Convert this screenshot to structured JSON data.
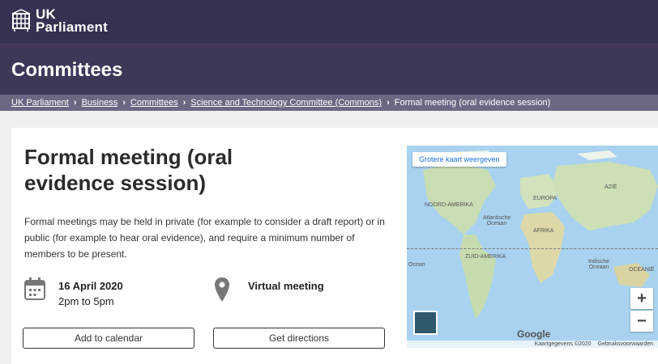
{
  "header": {
    "brand_line1": "UK",
    "brand_line2": "Parliament"
  },
  "section": {
    "title": "Committees"
  },
  "breadcrumb": {
    "items": [
      "UK Parliament",
      "Business",
      "Committees",
      "Science and Technology Committee (Commons)"
    ],
    "current": "Formal meeting (oral evidence session)"
  },
  "event": {
    "title": "Formal meeting (oral evidence session)",
    "description": "Formal meetings may be held in private (for example to consider a draft report) or in public (for example to hear oral evidence), and require a minimum number of members to be present.",
    "date": "16 April 2020",
    "time": "2pm to 5pm",
    "location": "Virtual meeting",
    "add_calendar_label": "Add to calendar",
    "directions_label": "Get directions"
  },
  "map": {
    "bigger_map_label": "Grotere kaart weergeven",
    "labels": {
      "north_america": "NOORD-AMERIKA",
      "europe": "EUROPA",
      "asia": "AZIË",
      "atlantic": "Atlantische Oceaan",
      "africa": "AFRIKA",
      "south_america": "ZUID-AMERIKA",
      "indian": "Indische Oceaan",
      "ocean_left": "Ocean",
      "oceania": "OCEANIË"
    },
    "zoom_in": "+",
    "zoom_out": "−",
    "google": "Google",
    "map_data": "Kaartgegevens ©2020",
    "terms": "Gebruiksvoorwaarden"
  },
  "colors": {
    "header_bg": "#373151",
    "section_bg": "#3f3658",
    "breadcrumb_bg": "#6e6782",
    "ocean": "#a8d2ef"
  }
}
